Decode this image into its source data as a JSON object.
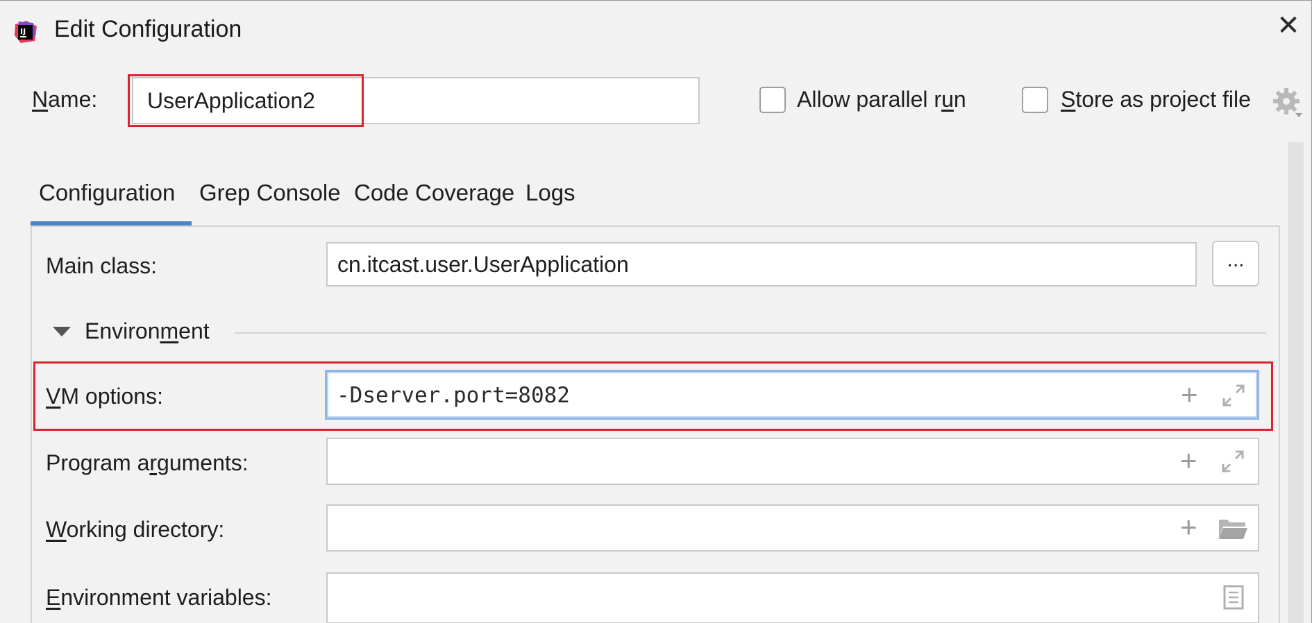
{
  "window": {
    "title": "Edit Configuration",
    "close_glyph": "✕"
  },
  "name_row": {
    "label_pre": "",
    "label_mnemonic": "N",
    "label_post": "ame:",
    "value": "UserApplication2",
    "allow_parallel": {
      "pre": "Allow parallel r",
      "mnemonic": "u",
      "post": "n",
      "checked": false
    },
    "store_project": {
      "pre": "",
      "mnemonic": "S",
      "post": "tore as project file",
      "checked": false
    }
  },
  "tabs": [
    "Configuration",
    "Grep Console",
    "Code Coverage",
    "Logs"
  ],
  "active_tab": "Configuration",
  "main_class": {
    "label": "Main class:",
    "value": "cn.itcast.user.UserApplication",
    "browse_label": "..."
  },
  "environment": {
    "pre": "Environ",
    "mnemonic": "m",
    "post": "ent",
    "expanded": true
  },
  "fields": {
    "vm_options": {
      "pre": "",
      "mnemonic": "V",
      "post": "M options:",
      "value": "-Dserver.port=8082"
    },
    "program_arguments": {
      "pre": "Program a",
      "mnemonic": "r",
      "post": "guments:",
      "value": ""
    },
    "working_directory": {
      "pre": "",
      "mnemonic": "W",
      "post": "orking directory:",
      "value": ""
    },
    "environment_variables": {
      "pre": "",
      "mnemonic": "E",
      "post": "nvironment variables:",
      "value": ""
    }
  },
  "icons": {
    "add": "+",
    "highlight_color": "#d9232e",
    "accent": "#4a83c9"
  }
}
